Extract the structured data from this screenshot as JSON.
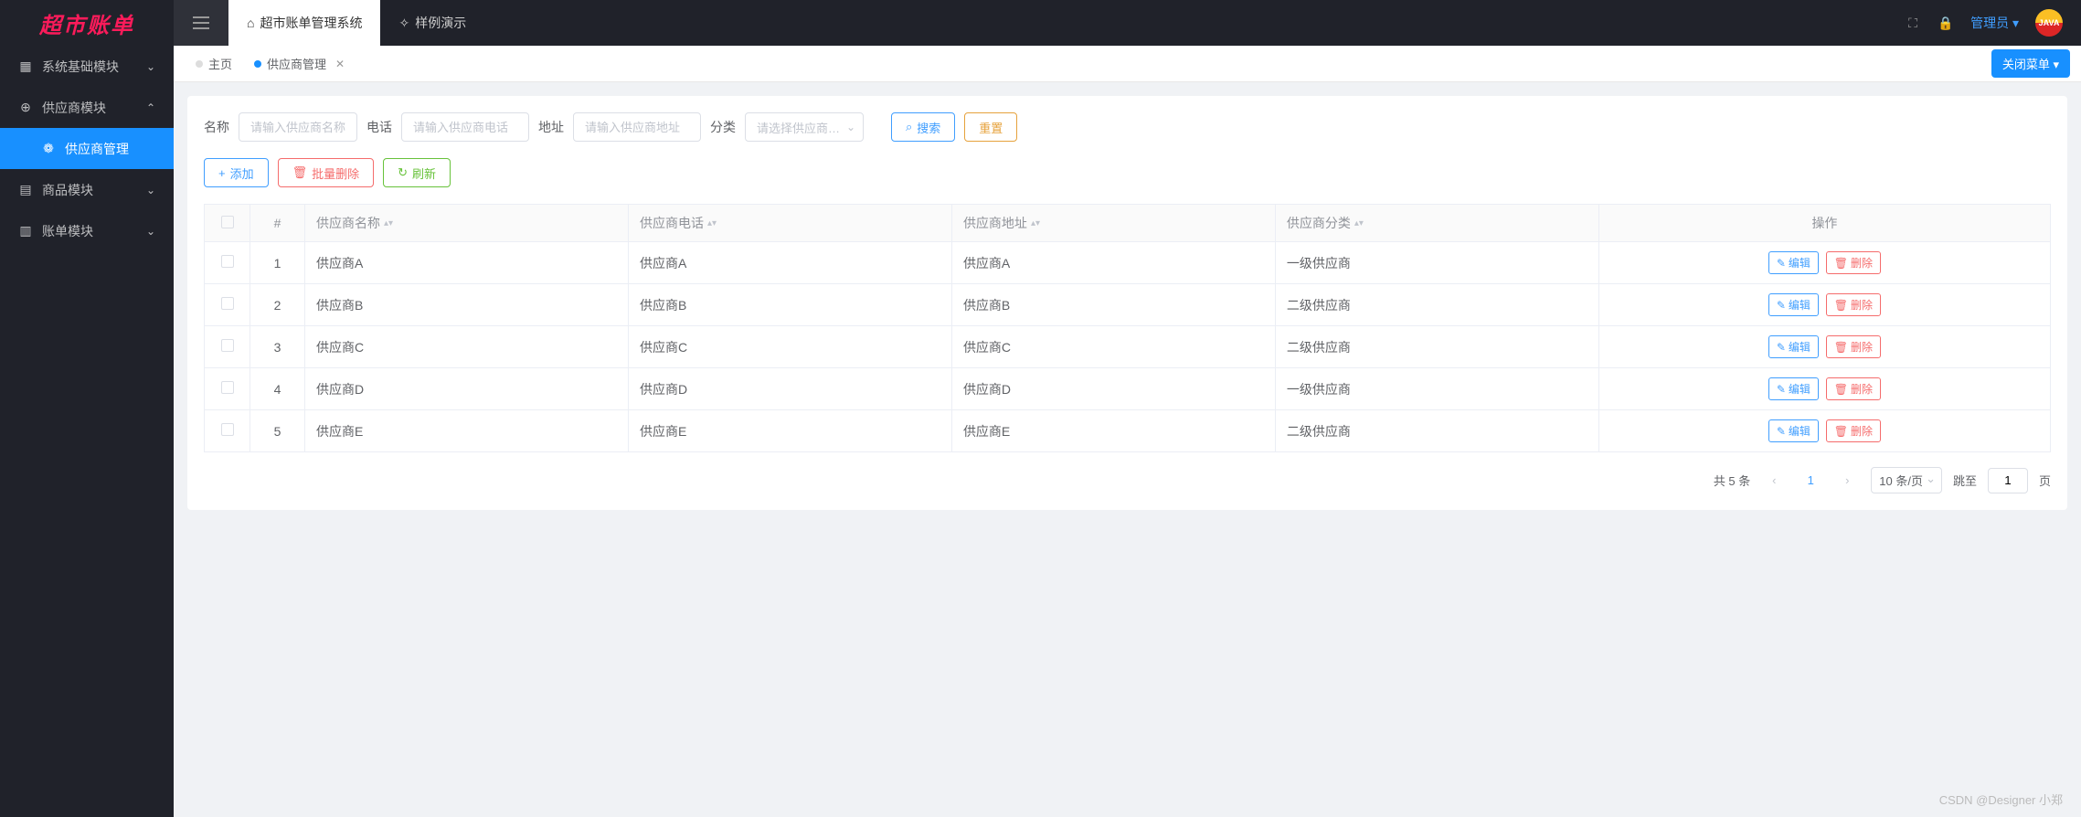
{
  "logo": "超市账单",
  "header": {
    "tabs": [
      {
        "label": "超市账单管理系统",
        "active": true
      },
      {
        "label": "样例演示",
        "active": false
      }
    ],
    "user": "管理员",
    "avatar_text": "JAVA"
  },
  "sidebar": {
    "items": [
      {
        "label": "系统基础模块",
        "icon": "layers",
        "expanded": false
      },
      {
        "label": "供应商模块",
        "icon": "globe",
        "expanded": true
      },
      {
        "label": "供应商管理",
        "icon": "gear",
        "sub": true,
        "active": true
      },
      {
        "label": "商品模块",
        "icon": "grid",
        "expanded": false
      },
      {
        "label": "账单模块",
        "icon": "doc",
        "expanded": false
      }
    ]
  },
  "pageTabs": {
    "items": [
      {
        "label": "主页",
        "active": false
      },
      {
        "label": "供应商管理",
        "active": true,
        "closable": true
      }
    ],
    "closeMenu": "关闭菜单"
  },
  "search": {
    "name_label": "名称",
    "name_placeholder": "请输入供应商名称",
    "phone_label": "电话",
    "phone_placeholder": "请输入供应商电话",
    "address_label": "地址",
    "address_placeholder": "请输入供应商地址",
    "category_label": "分类",
    "category_placeholder": "请选择供应商…",
    "search_btn": "搜索",
    "reset_btn": "重置"
  },
  "actions": {
    "add": "添加",
    "batch_delete": "批量删除",
    "refresh": "刷新"
  },
  "table": {
    "headers": {
      "index": "#",
      "name": "供应商名称",
      "phone": "供应商电话",
      "address": "供应商地址",
      "category": "供应商分类",
      "ops": "操作"
    },
    "rows": [
      {
        "idx": "1",
        "name": "供应商A",
        "phone": "供应商A",
        "address": "供应商A",
        "category": "一级供应商"
      },
      {
        "idx": "2",
        "name": "供应商B",
        "phone": "供应商B",
        "address": "供应商B",
        "category": "二级供应商"
      },
      {
        "idx": "3",
        "name": "供应商C",
        "phone": "供应商C",
        "address": "供应商C",
        "category": "二级供应商"
      },
      {
        "idx": "4",
        "name": "供应商D",
        "phone": "供应商D",
        "address": "供应商D",
        "category": "一级供应商"
      },
      {
        "idx": "5",
        "name": "供应商E",
        "phone": "供应商E",
        "address": "供应商E",
        "category": "二级供应商"
      }
    ],
    "edit": "编辑",
    "delete": "删除"
  },
  "pagination": {
    "total": "共 5 条",
    "current": "1",
    "page_size": "10 条/页",
    "jump_label": "跳至",
    "jump_value": "1",
    "page_unit": "页"
  },
  "watermark": "CSDN @Designer 小郑"
}
